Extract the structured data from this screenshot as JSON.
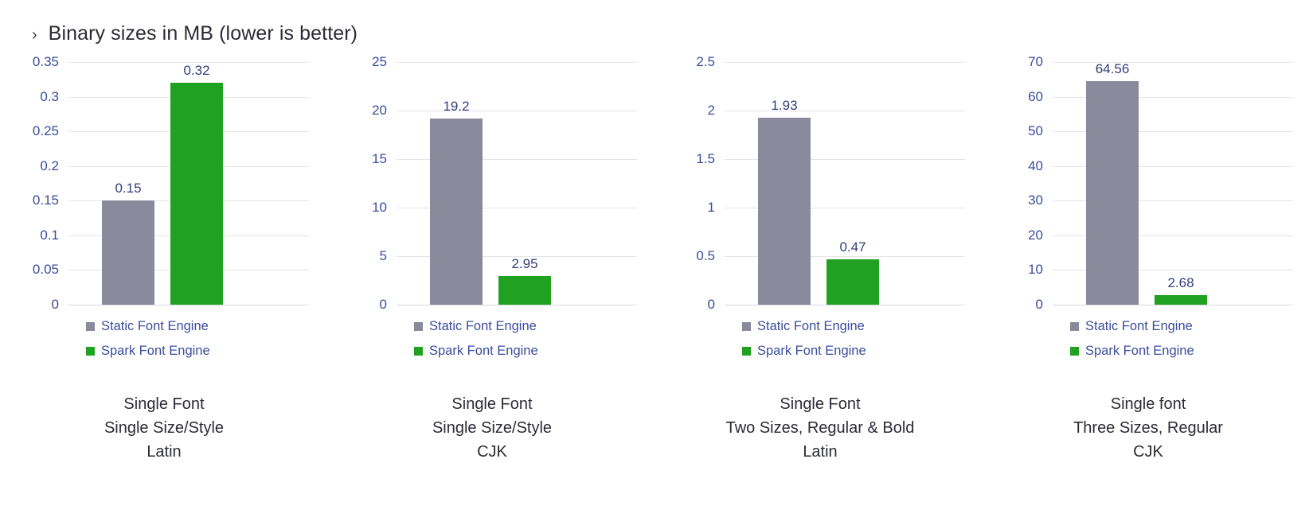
{
  "slide": {
    "bullet_glyph": "›",
    "title": "Binary sizes in MB (lower is better)"
  },
  "colors": {
    "static_bar": "#8a8a9c",
    "spark_bar": "#21a121",
    "tick_text": "#3b4c9b",
    "data_label": "#323e7a",
    "caption_text": "#2b2b35",
    "gridline": "#e4e4ea"
  },
  "legend": {
    "static_label": "Static Font Engine",
    "spark_label": "Spark Font Engine",
    "static_swatch_name": "gray-square-swatch",
    "spark_swatch_name": "green-square-swatch"
  },
  "chart_data": [
    {
      "type": "bar",
      "title": "Single Font Single Size/Style Latin",
      "categories": [
        "Static Font Engine",
        "Spark Font Engine"
      ],
      "values": [
        0.15,
        0.32
      ],
      "labels": [
        "0.15",
        "0.32"
      ],
      "ylabel": "",
      "xlabel": "",
      "ylim": [
        0,
        0.35
      ],
      "yticks": [
        0.35,
        0.3,
        0.25,
        0.2,
        0.15,
        0.1,
        0.05,
        0
      ],
      "ytick_labels": [
        "0.35",
        "0.3",
        "0.25",
        "0.2",
        "0.15",
        "0.1",
        "0.05",
        "0"
      ],
      "grid": true,
      "legend_position": "bottom-left",
      "caption_lines": [
        "Single Font",
        "Single Size/Style",
        "Latin"
      ]
    },
    {
      "type": "bar",
      "title": "Single Font Single Size/Style CJK",
      "categories": [
        "Static Font Engine",
        "Spark Font Engine"
      ],
      "values": [
        19.2,
        2.95
      ],
      "labels": [
        "19.2",
        "2.95"
      ],
      "ylabel": "",
      "xlabel": "",
      "ylim": [
        0,
        25
      ],
      "yticks": [
        25,
        20,
        15,
        10,
        5,
        0
      ],
      "ytick_labels": [
        "25",
        "20",
        "15",
        "10",
        "5",
        "0"
      ],
      "grid": true,
      "legend_position": "bottom-left",
      "caption_lines": [
        "Single Font",
        "Single Size/Style",
        "CJK"
      ]
    },
    {
      "type": "bar",
      "title": "Single Font Two Sizes, Regular & Bold Latin",
      "categories": [
        "Static Font Engine",
        "Spark Font Engine"
      ],
      "values": [
        1.93,
        0.47
      ],
      "labels": [
        "1.93",
        "0.47"
      ],
      "ylabel": "",
      "xlabel": "",
      "ylim": [
        0,
        2.5
      ],
      "yticks": [
        2.5,
        2,
        1.5,
        1,
        0.5,
        0
      ],
      "ytick_labels": [
        "2.5",
        "2",
        "1.5",
        "1",
        "0.5",
        "0"
      ],
      "grid": true,
      "legend_position": "bottom-left",
      "caption_lines": [
        "Single Font",
        "Two Sizes, Regular & Bold",
        "Latin"
      ]
    },
    {
      "type": "bar",
      "title": "Single font Three Sizes, Regular CJK",
      "categories": [
        "Static Font Engine",
        "Spark Font Engine"
      ],
      "values": [
        64.56,
        2.68
      ],
      "labels": [
        "64.56",
        "2.68"
      ],
      "ylabel": "",
      "xlabel": "",
      "ylim": [
        0,
        70
      ],
      "yticks": [
        70,
        60,
        50,
        40,
        30,
        20,
        10,
        0
      ],
      "ytick_labels": [
        "70",
        "60",
        "50",
        "40",
        "30",
        "20",
        "10",
        "0"
      ],
      "grid": true,
      "legend_position": "bottom-left",
      "caption_lines": [
        "Single font",
        "Three Sizes, Regular",
        "CJK"
      ]
    }
  ]
}
